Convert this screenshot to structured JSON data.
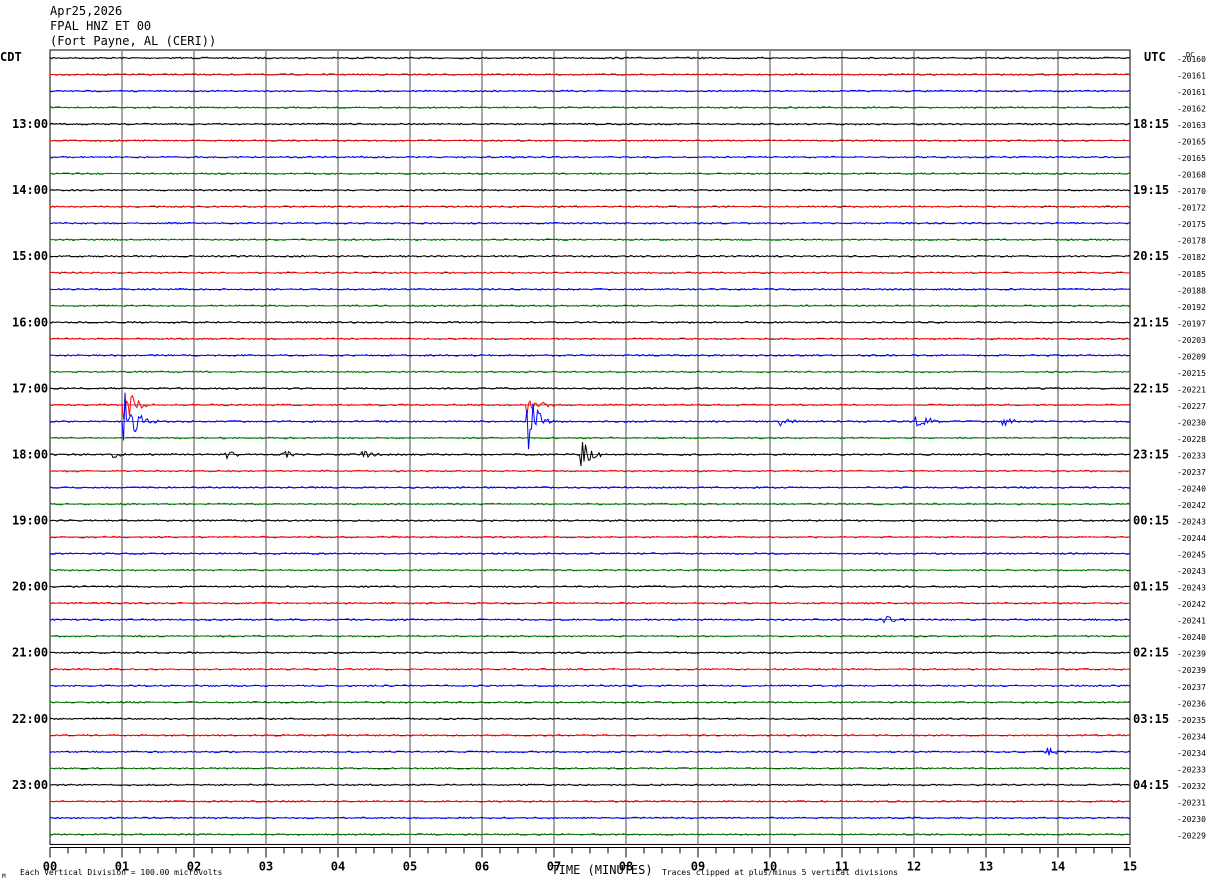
{
  "header": {
    "date": "Apr25,2026",
    "station": "FPAL HNZ ET 00",
    "location": "(Fort Payne, AL (CERI))"
  },
  "chart_data": {
    "type": "helicorder",
    "left_tz": "CDT",
    "right_tz": "UTC",
    "dc_label": "DC",
    "xlabel": "TIME (MINUTES)",
    "xticks": [
      "00",
      "01",
      "02",
      "03",
      "04",
      "05",
      "06",
      "07",
      "08",
      "09",
      "10",
      "11",
      "12",
      "13",
      "14",
      "15"
    ],
    "xlim": [
      0,
      15
    ],
    "left_labels": [
      {
        "row": 4,
        "text": "13:00"
      },
      {
        "row": 8,
        "text": "14:00"
      },
      {
        "row": 12,
        "text": "15:00"
      },
      {
        "row": 16,
        "text": "16:00"
      },
      {
        "row": 20,
        "text": "17:00"
      },
      {
        "row": 24,
        "text": "18:00"
      },
      {
        "row": 28,
        "text": "19:00"
      },
      {
        "row": 32,
        "text": "20:00"
      },
      {
        "row": 36,
        "text": "21:00"
      },
      {
        "row": 40,
        "text": "22:00"
      },
      {
        "row": 44,
        "text": "23:00"
      }
    ],
    "right_labels": [
      {
        "row": 4,
        "text": "18:15"
      },
      {
        "row": 8,
        "text": "19:15"
      },
      {
        "row": 12,
        "text": "20:15"
      },
      {
        "row": 16,
        "text": "21:15"
      },
      {
        "row": 20,
        "text": "22:15"
      },
      {
        "row": 24,
        "text": "23:15"
      },
      {
        "row": 28,
        "text": "00:15"
      },
      {
        "row": 32,
        "text": "01:15"
      },
      {
        "row": 36,
        "text": "02:15"
      },
      {
        "row": 40,
        "text": "03:15"
      },
      {
        "row": 44,
        "text": "04:15"
      }
    ],
    "dc_values": [
      "-20160",
      "-20161",
      "-20161",
      "-20162",
      "-20163",
      "-20165",
      "-20165",
      "-20168",
      "-20170",
      "-20172",
      "-20175",
      "-20178",
      "-20182",
      "-20185",
      "-20188",
      "-20192",
      "-20197",
      "-20203",
      "-20209",
      "-20215",
      "-20221",
      "-20227",
      "-20230",
      "-20228",
      "-20233",
      "-20237",
      "-20240",
      "-20242",
      "-20243",
      "-20244",
      "-20245",
      "-20243",
      "-20243",
      "-20242",
      "-20241",
      "-20240",
      "-20239",
      "-20239",
      "-20237",
      "-20236",
      "-20235",
      "-20234",
      "-20234",
      "-20233",
      "-20232",
      "-20231",
      "-20230",
      "-20229"
    ],
    "trace_colors": [
      "#000000",
      "#ff0000",
      "#0000ff",
      "#008000"
    ],
    "events": [
      {
        "row": 22,
        "minute": 1.05,
        "amplitude": 2.0
      },
      {
        "row": 21,
        "minute": 1.05,
        "amplitude": 1.2
      },
      {
        "row": 22,
        "minute": 6.65,
        "amplitude": 1.8
      },
      {
        "row": 21,
        "minute": 6.65,
        "amplitude": 0.8
      },
      {
        "row": 24,
        "minute": 7.4,
        "amplitude": 0.8
      },
      {
        "row": 24,
        "minute": 0.9,
        "amplitude": 0.25
      },
      {
        "row": 24,
        "minute": 2.45,
        "amplitude": 0.3
      },
      {
        "row": 24,
        "minute": 3.25,
        "amplitude": 0.25
      },
      {
        "row": 24,
        "minute": 4.35,
        "amplitude": 0.3
      },
      {
        "row": 22,
        "minute": 12.05,
        "amplitude": 0.7
      },
      {
        "row": 22,
        "minute": 10.15,
        "amplitude": 0.3
      },
      {
        "row": 22,
        "minute": 13.25,
        "amplitude": 0.3
      },
      {
        "row": 34,
        "minute": 11.6,
        "amplitude": 0.4
      },
      {
        "row": 42,
        "minute": 13.85,
        "amplitude": 0.35
      }
    ]
  },
  "footer": {
    "scale": "Each Vertical Division =  100.00 microvolts",
    "clip": "Traces clipped at plus/minus 5 vertical divisions",
    "corner": "M"
  }
}
